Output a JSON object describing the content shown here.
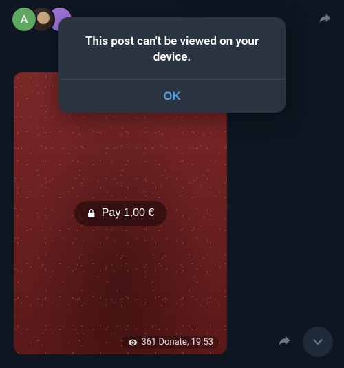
{
  "header": {
    "avatar_a_initial": "A"
  },
  "post": {
    "pay_label": "Pay 1,00 €",
    "meta_text": "361 Donate, 19:53"
  },
  "dialog": {
    "message": "This post can't be viewed on your device.",
    "ok_label": "OK"
  }
}
